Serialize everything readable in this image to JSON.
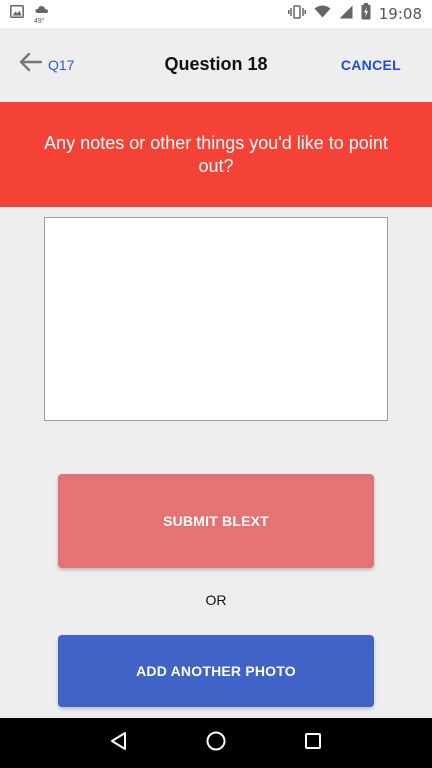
{
  "status_bar": {
    "time": "19:08",
    "weather_temp": "49°",
    "icons": [
      "image-icon",
      "weather-icon",
      "vibrate-icon",
      "wifi-icon",
      "signal-icon",
      "battery-icon"
    ]
  },
  "header": {
    "back_label": "Q17",
    "title": "Question 18",
    "cancel_label": "CANCEL"
  },
  "question": {
    "text": "Any notes or other things you'd like to point out?"
  },
  "notes_input": {
    "value": "",
    "placeholder": ""
  },
  "actions": {
    "submit_label": "SUBMIT BLEXT",
    "or_label": "OR",
    "add_photo_label": "ADD ANOTHER PHOTO"
  },
  "nav_bar": {
    "icons": [
      "back-triangle-icon",
      "home-circle-icon",
      "recents-square-icon"
    ]
  },
  "colors": {
    "banner": "#f44336",
    "submit_button": "#e57373",
    "add_photo_button": "#3f63c7",
    "link_blue": "#1f4fd0",
    "background": "#eeeeee"
  }
}
